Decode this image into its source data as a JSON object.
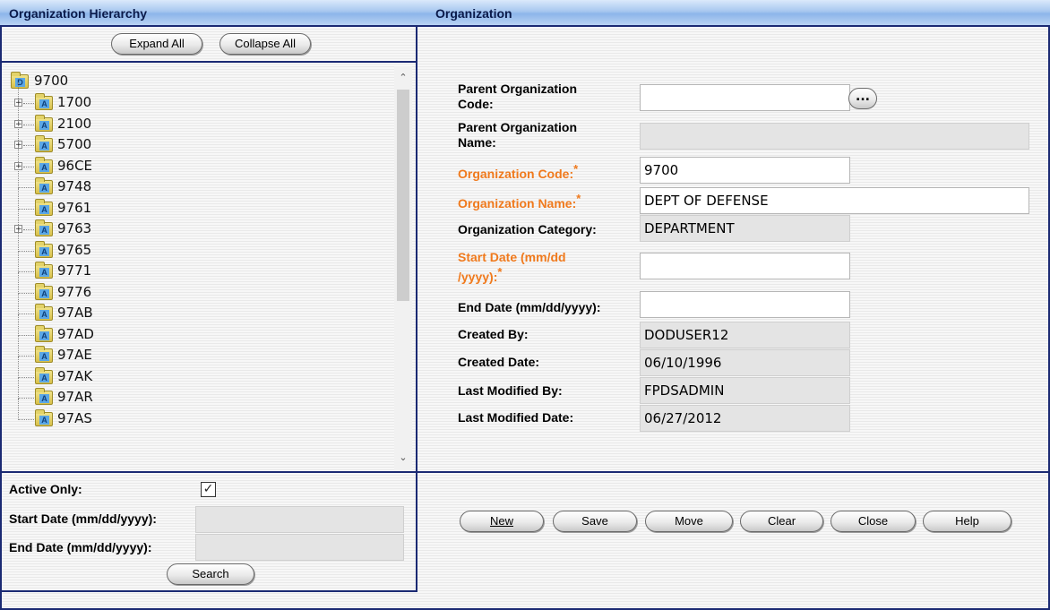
{
  "left_header": "Organization Hierarchy",
  "right_header": "Organization",
  "hierarchy": {
    "expand_all": "Expand All",
    "collapse_all": "Collapse All",
    "root": "9700",
    "items": [
      "1700",
      "2100",
      "5700",
      "96CE",
      "9748",
      "9761",
      "9763",
      "9765",
      "9771",
      "9776",
      "97AB",
      "97AD",
      "97AE",
      "97AK",
      "97AR",
      "97AS"
    ],
    "expandable": [
      "1700",
      "2100",
      "5700",
      "96CE",
      "9763"
    ]
  },
  "filters": {
    "active_only_label": "Active Only:",
    "active_only_checked": "✓",
    "start_date_label": "Start Date (mm/dd/yyyy):",
    "end_date_label": "End Date (mm/dd/yyyy):",
    "search_button": "Search"
  },
  "form": {
    "parent_code_label_1": "Parent Organization",
    "parent_code_label_2": "Code:",
    "parent_code_value": "",
    "parent_name_label_1": "Parent Organization",
    "parent_name_label_2": "Name:",
    "parent_name_value": "",
    "org_code_label": "Organization Code:",
    "org_code_value": "9700",
    "org_name_label": "Organization Name:",
    "org_name_value": "DEPT OF DEFENSE",
    "org_category_label": "Organization Category:",
    "org_category_value": "DEPARTMENT",
    "start_date_label_1": "Start Date (mm/dd",
    "start_date_label_2": "/yyyy):",
    "start_date_value": "",
    "end_date_label": "End Date (mm/dd/yyyy):",
    "end_date_value": "",
    "created_by_label": "Created By:",
    "created_by_value": "DODUSER12",
    "created_date_label": "Created Date:",
    "created_date_value": "06/10/1996",
    "last_modified_by_label": "Last Modified By:",
    "last_modified_by_value": "FPDSADMIN",
    "last_modified_date_label": "Last Modified Date:",
    "last_modified_date_value": "06/27/2012",
    "required_star": "*",
    "lookup_button": "..."
  },
  "actions": {
    "new": "New",
    "save": "Save",
    "move": "Move",
    "clear": "Clear",
    "close": "Close",
    "help": "Help"
  },
  "colors": {
    "navy_border": "#1b2a73",
    "required_orange": "#f07a1d"
  }
}
